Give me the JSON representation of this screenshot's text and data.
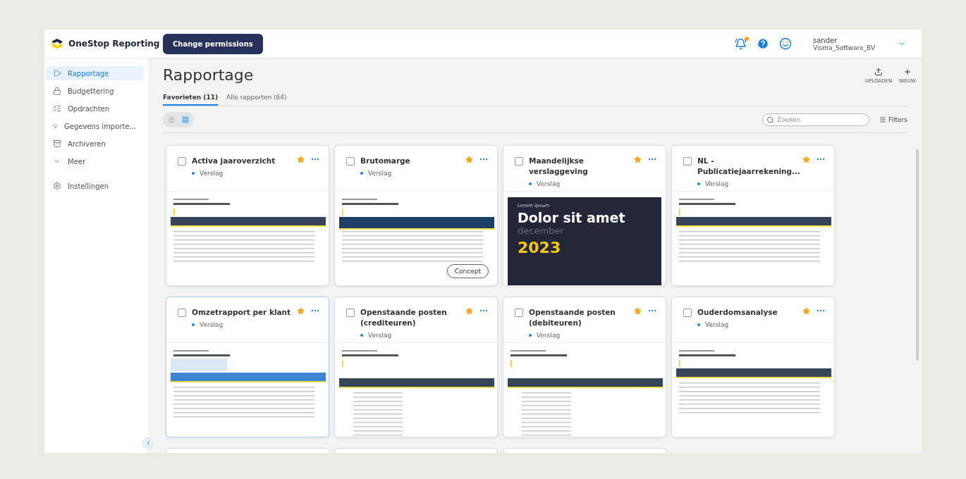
{
  "header": {
    "brand": "OneStop Reporting",
    "action_button": "Change permissions",
    "notification_dot": true,
    "user": {
      "name": "sander",
      "company": "Visma_Software_BV"
    }
  },
  "sidebar": {
    "items": [
      {
        "label": "Rapportage",
        "selected": true
      },
      {
        "label": "Budgettering",
        "selected": false
      },
      {
        "label": "Opdrachten",
        "selected": false
      },
      {
        "label": "Gegevens importe...",
        "selected": false
      },
      {
        "label": "Archiveren",
        "selected": false
      },
      {
        "label": "Meer",
        "selected": false
      },
      {
        "label": "Instellingen",
        "selected": false
      }
    ]
  },
  "page": {
    "title": "Rapportage",
    "actions": [
      {
        "label": "UPLOADEN"
      },
      {
        "label": "NIEUW"
      }
    ],
    "tabs": [
      {
        "label": "Favorieten (11)",
        "selected": true
      },
      {
        "label": "Alle rapporten (64)",
        "selected": false
      }
    ],
    "view_toggle": [
      {
        "kind": "list",
        "selected": false
      },
      {
        "kind": "grid",
        "selected": true
      }
    ],
    "search": {
      "placeholder": "Zoeken"
    },
    "filters": "Filters"
  },
  "cards": [
    {
      "kind": "report",
      "title": "Activa jaaroverzicht",
      "type": "Verslag",
      "checked": false,
      "starred": true,
      "highlighted": false,
      "preview": {
        "kind": "table"
      }
    },
    {
      "kind": "report",
      "title": "Brutomarge",
      "type": "Verslag",
      "checked": false,
      "starred": true,
      "highlighted": false,
      "preview": {
        "kind": "figures",
        "badge": "Concept"
      }
    },
    {
      "kind": "report",
      "title": "Maandelijkse verslaggeving",
      "type": "Verslag",
      "checked": false,
      "starred": true,
      "highlighted": false,
      "preview": {
        "kind": "cover",
        "eyebrow": "Lorem ipsum",
        "headline": "Dolor sit amet",
        "month": "december",
        "year": "2023"
      }
    },
    {
      "kind": "report",
      "title": "NL - Publicatiejaarrekening...",
      "type": "Verslag",
      "checked": false,
      "starred": true,
      "highlighted": false,
      "preview": {
        "kind": "table"
      }
    },
    {
      "kind": "report",
      "title": "Omzetrapport per klant",
      "type": "Verslag",
      "checked": false,
      "starred": true,
      "highlighted": true,
      "preview": {
        "kind": "blue-table"
      }
    },
    {
      "kind": "report",
      "title": "Openstaande posten (crediteuren)",
      "type": "Verslag",
      "checked": false,
      "starred": true,
      "highlighted": false,
      "preview": {
        "kind": "list"
      }
    },
    {
      "kind": "report",
      "title": "Openstaande posten (debiteuren)",
      "type": "Verslag",
      "checked": false,
      "starred": true,
      "highlighted": false,
      "preview": {
        "kind": "list"
      }
    },
    {
      "kind": "report",
      "title": "Ouderdomsanalyse",
      "type": "Verslag",
      "checked": false,
      "starred": true,
      "highlighted": false,
      "preview": {
        "kind": "table"
      }
    },
    {
      "kind": "clipped"
    },
    {
      "kind": "clipped"
    },
    {
      "kind": "clipped"
    }
  ]
}
